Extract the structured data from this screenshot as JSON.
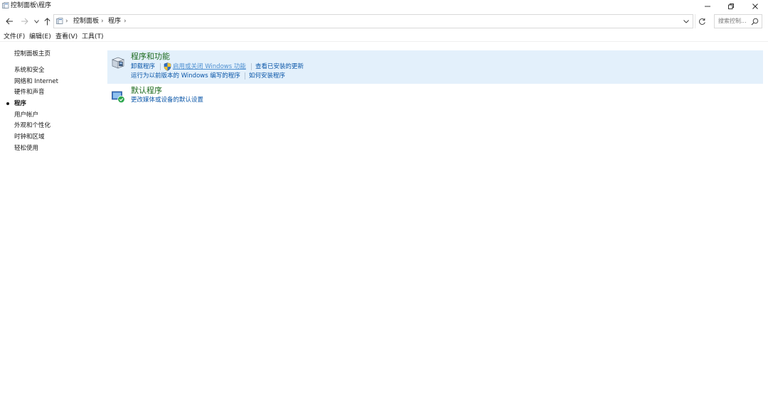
{
  "titlebar": {
    "title": "控制面板\\程序",
    "minimize_icon": "minimize-icon",
    "restore_icon": "restore-icon",
    "close_icon": "close-icon"
  },
  "navigation": {
    "back_icon": "arrow-left-icon",
    "forward_icon": "arrow-right-icon",
    "recent_icon": "chevron-down-icon",
    "up_icon": "arrow-up-icon"
  },
  "address": {
    "separator": "›",
    "crumbs": [
      "控制面板",
      "程序"
    ],
    "refresh_icon": "refresh-icon"
  },
  "search": {
    "placeholder": "搜索控制...",
    "icon": "search-icon"
  },
  "menu": {
    "items": [
      "文件(F)",
      "编辑(E)",
      "查看(V)",
      "工具(T)"
    ]
  },
  "sidebar": {
    "home": "控制面板主页",
    "items": [
      {
        "label": "系统和安全",
        "active": false
      },
      {
        "label": "网络和 Internet",
        "active": false
      },
      {
        "label": "硬件和声音",
        "active": false
      },
      {
        "label": "程序",
        "active": true
      },
      {
        "label": "用户帐户",
        "active": false
      },
      {
        "label": "外观和个性化",
        "active": false
      },
      {
        "label": "时钟和区域",
        "active": false
      },
      {
        "label": "轻松使用",
        "active": false
      }
    ]
  },
  "main": {
    "programs": {
      "title": "程序和功能",
      "links": {
        "uninstall": "卸载程序",
        "features": "启用或关闭 Windows 功能",
        "updates": "查看已安装的更新",
        "compat": "运行为以前版本的 Windows 编写的程序",
        "howto": "如何安装程序"
      }
    },
    "defaults": {
      "title": "默认程序",
      "links": {
        "defaults": "更改媒体或设备的默认设置"
      }
    }
  },
  "colors": {
    "link": "#0a56a8",
    "section_title": "#1e6b1e",
    "highlight": "#e3f0fb"
  }
}
